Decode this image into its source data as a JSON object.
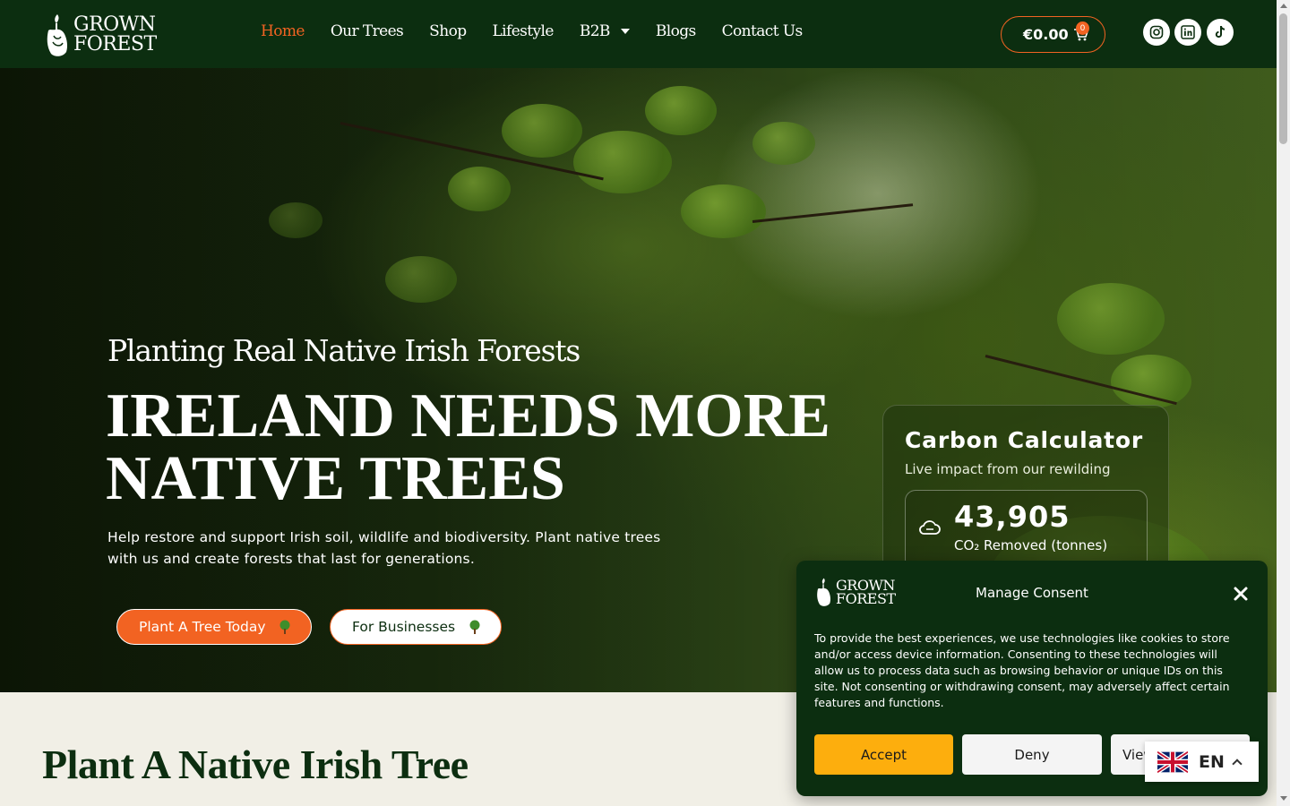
{
  "brand": {
    "name_line1": "GROWN",
    "name_line2": "FOREST"
  },
  "nav": {
    "items": [
      {
        "label": "Home",
        "active": true
      },
      {
        "label": "Our Trees"
      },
      {
        "label": "Shop"
      },
      {
        "label": "Lifestyle"
      },
      {
        "label": "B2B",
        "has_dropdown": true
      },
      {
        "label": "Blogs"
      },
      {
        "label": "Contact Us"
      }
    ]
  },
  "cart": {
    "total": "€0.00",
    "count": "0",
    "icon": "cart-icon"
  },
  "social": [
    {
      "name": "instagram-icon"
    },
    {
      "name": "linkedin-icon"
    },
    {
      "name": "tiktok-icon"
    }
  ],
  "hero": {
    "kicker": "Planting Real Native Irish Forests",
    "title_line1": "IRELAND NEEDS MORE",
    "title_line2": "NATIVE TREES",
    "text": "Help restore and support Irish soil, wildlife and biodiversity. Plant native trees with us and create forests that last for generations.",
    "primary_button": "Plant A Tree Today",
    "secondary_button": "For Businesses"
  },
  "calculator": {
    "title": "Carbon Calculator",
    "subtitle": "Live impact from our rewilding",
    "value": "43,905",
    "label": "CO₂ Removed (tonnes)"
  },
  "section": {
    "title": "Plant A Native Irish Tree"
  },
  "consent": {
    "title": "Manage Consent",
    "text": "To provide the best experiences, we use technologies like cookies to store and/or access device information. Consenting to these technologies will allow us to process data such as browsing behavior or unique IDs on this site. Not consenting or withdrawing consent, may adversely affect certain features and functions.",
    "accept": "Accept",
    "deny": "Deny",
    "view": "View preferences"
  },
  "language": {
    "code": "EN"
  },
  "colors": {
    "header_bg": "#0c2e10",
    "accent": "#f26322",
    "accept_btn": "#fdae0d"
  }
}
